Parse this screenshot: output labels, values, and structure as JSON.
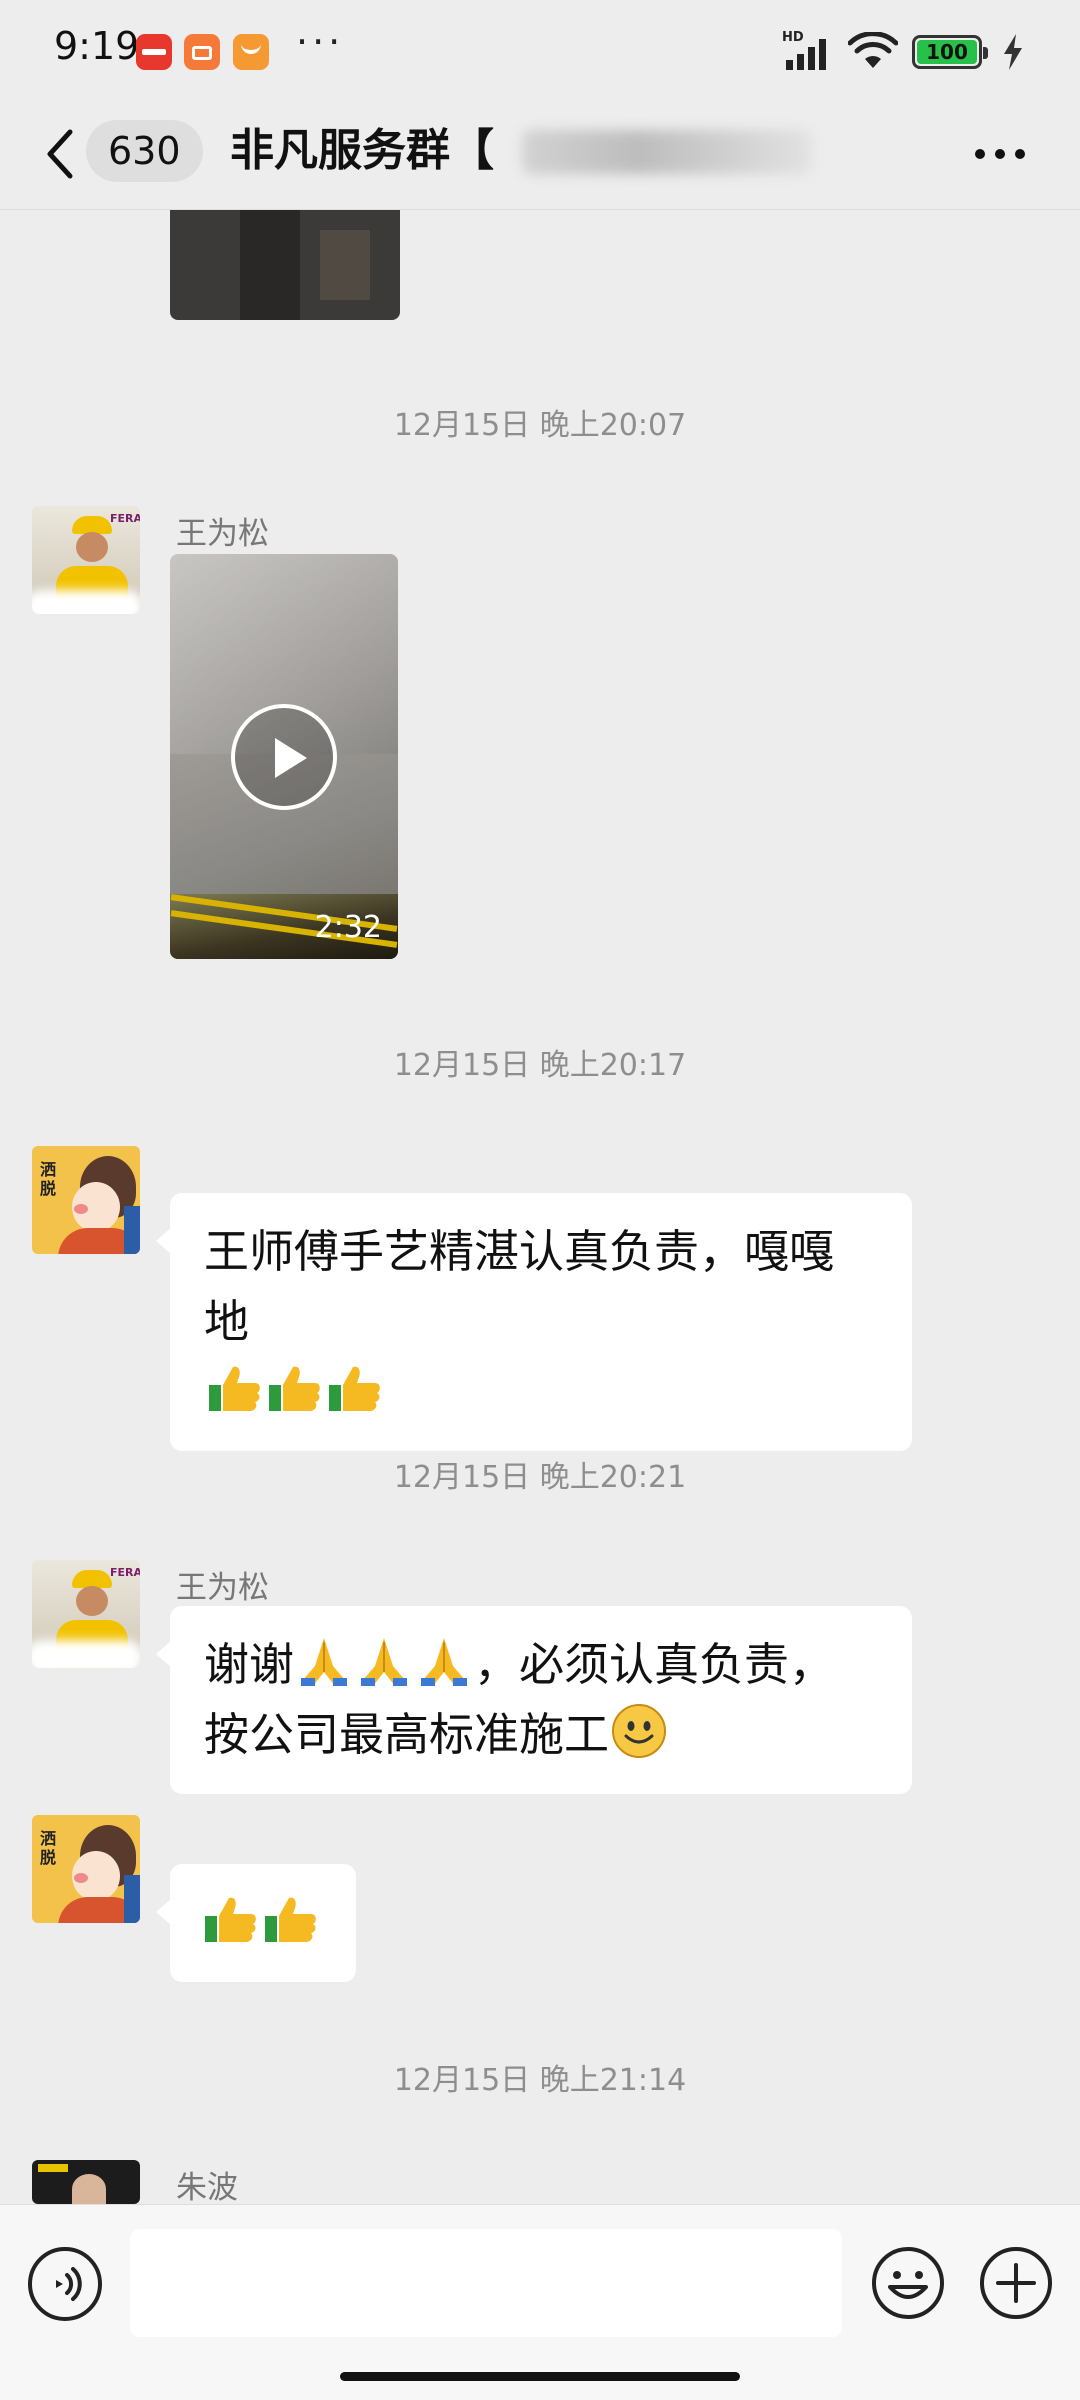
{
  "status_bar": {
    "time": "9:19",
    "battery": "100",
    "network": "HD"
  },
  "header": {
    "unread_count": "630",
    "title": "非凡服务群【"
  },
  "messages": [
    {
      "type": "timestamp",
      "text": "12月15日 晚上20:07"
    },
    {
      "type": "video",
      "sender": "王为松",
      "duration": "2:32"
    },
    {
      "type": "timestamp",
      "text": "12月15日 晚上20:17"
    },
    {
      "type": "text",
      "sender": "",
      "text": "王师傅手艺精湛认真负责，嘎嘎地"
    },
    {
      "type": "timestamp",
      "text": "12月15日 晚上20:21"
    },
    {
      "type": "text",
      "sender": "王为松",
      "text_a": "谢谢",
      "text_b": "，必须认真负责，按公司最高标准施工"
    },
    {
      "type": "emoji_only",
      "sender": ""
    },
    {
      "type": "timestamp",
      "text": "12月15日 晚上21:14"
    },
    {
      "type": "partial",
      "sender": "朱波"
    }
  ],
  "avatars": {
    "worker": "王为松",
    "customer_badge": "洒脱",
    "third": "朱波"
  },
  "colors": {
    "background": "#ededed",
    "bubble": "#ffffff",
    "timestamp": "#8e8e8e",
    "battery_green": "#27c14a"
  },
  "icons": [
    "back-arrow-icon",
    "more-dots-icon",
    "voice-icon",
    "emoji-icon",
    "plus-icon",
    "play-icon",
    "thumbs-up-icon",
    "pray-hands-icon",
    "smile-icon",
    "wifi-icon",
    "signal-icon",
    "battery-icon",
    "charging-icon"
  ],
  "input": {
    "placeholder": ""
  }
}
